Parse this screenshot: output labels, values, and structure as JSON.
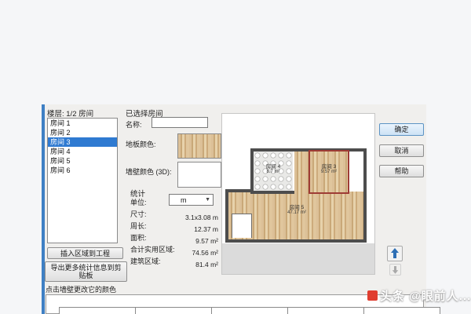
{
  "dialog": {
    "left_panel": {
      "header": "楼层: 1/2 房间",
      "rooms": [
        "房间 1",
        "房间 2",
        "房间 3",
        "房间 4",
        "房间 5",
        "房间 6"
      ],
      "selected_index": 2,
      "insert_button": "插入区域到工程",
      "export_button": "导出更多统计信息到剪贴板"
    },
    "form": {
      "section_title": "已选择房间",
      "name_label": "名称:",
      "name_value": "",
      "floor_color_label": "地板颜色:",
      "wall_color_label": "墙壁颜色 (3D):",
      "stats": {
        "title": "统计",
        "unit_label": "单位:",
        "unit_value": "m",
        "rows": [
          {
            "label": "尺寸:",
            "value": "3.1x3.08 m"
          },
          {
            "label": "周长:",
            "value": "12.37 m"
          },
          {
            "label": "面积:",
            "value": "9.57 m²"
          },
          {
            "label": "合计实用区域:",
            "value": "74.56 m²"
          },
          {
            "label": "建筑区域:",
            "value": "81.4 m²"
          }
        ]
      }
    },
    "plan": {
      "rooms": [
        {
          "name": "房间 4",
          "area": "8.7 m²"
        },
        {
          "name": "房间 3",
          "area": "9.57 m²"
        },
        {
          "name": "房间 5",
          "area": "47.17 m²"
        }
      ]
    },
    "buttons": {
      "ok": "确定",
      "cancel": "取消",
      "help": "帮助"
    },
    "footer_hint": "点击墙壁更改它的颜色"
  },
  "watermark": "头条 @眼前人...",
  "colors": {
    "accent_blue": "#2f7ad1",
    "selected_room_border": "#9e3c35",
    "wood_base": "#d6b98e",
    "wall": "#4d4d4d"
  }
}
